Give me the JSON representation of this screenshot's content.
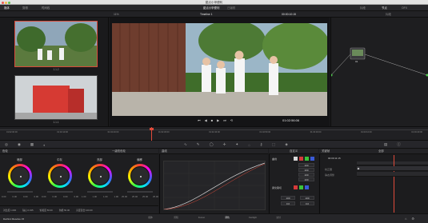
{
  "window": {
    "title": "甜点小甲便利"
  },
  "topbar": {
    "left_items": [
      "媒体",
      "剪辑",
      "时间线"
    ],
    "center": {
      "project": "甜点小甲便利",
      "status": "已编辑"
    },
    "right_items": [
      "片段",
      "节点",
      "OFX"
    ]
  },
  "toolbar2": {
    "zoom": "11%",
    "timeline": "Timeline 1",
    "timecode": "00:00:10:15",
    "clips": "片段"
  },
  "gallery": {
    "captions": [
      "1.1.2",
      "1.1.1"
    ]
  },
  "viewer": {
    "timecode": "01:02:56:06"
  },
  "nodes": {
    "node_label": "01"
  },
  "timeline_strip": {
    "markers": [
      "01:02:00:00",
      "01:02:10:00",
      "01:02:20:00",
      "01:02:30:00",
      "01:02:40:00",
      "01:02:50:00",
      "01:03:00:00",
      "01:03:10:00",
      "01:03:20:00"
    ]
  },
  "panels": {
    "wheels": "色轮",
    "primary": "一级校色轮",
    "curves": "曲线",
    "custom": "自定义",
    "keyframes": "关键帧",
    "all": "全部"
  },
  "wheels": [
    {
      "label": "暗部",
      "values": [
        "0.00",
        "0.00",
        "0.00",
        "0.00"
      ]
    },
    {
      "label": "中灰",
      "values": [
        "0.00",
        "0.00",
        "0.00",
        "0.00"
      ]
    },
    {
      "label": "亮部",
      "values": [
        "1.00",
        "1.00",
        "1.00",
        "1.00"
      ]
    },
    {
      "label": "偏移",
      "values": [
        "25.00",
        "25.00",
        "25.00",
        "25.00"
      ]
    }
  ],
  "adjust": {
    "items": [
      "对比度 1.000",
      "轴心 0.435",
      "饱和度 50.00",
      "色相 50.00",
      "亮度混合 100.00"
    ]
  },
  "custom": {
    "label1": "曲线",
    "values": [
      "100",
      "100",
      "100",
      "100"
    ],
    "label2": "柔化裁切",
    "soft": [
      "100",
      "100",
      "0.0",
      "0.0"
    ]
  },
  "keyframes": {
    "timecode": "00:00:11:15",
    "rows": [
      "校正器",
      "静态调整"
    ]
  },
  "bottombar": {
    "app": "DaVinci Resolve 15",
    "pages": [
      "媒体",
      "剪辑",
      "Fusion",
      "调色",
      "Fairlight",
      "交付"
    ],
    "active_page": "调色"
  }
}
